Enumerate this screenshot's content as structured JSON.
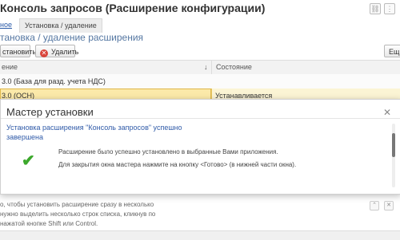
{
  "window": {
    "title": "Консоль запросов (Расширение конфигурации)",
    "icons": [
      "link-icon",
      "more-icon"
    ]
  },
  "tabs": {
    "prev_label": "ное",
    "active_label": "Установка / удаление"
  },
  "section_title": "тановка / удаление расширения",
  "toolbar": {
    "install_label": "становить",
    "delete_label": "Удалить",
    "more_label": "Ещ"
  },
  "table": {
    "col_name_header": "ение",
    "col_state_header": "Состояние",
    "sort_icon": "↓",
    "rows": [
      {
        "name": "3.0 (База для разд. учета НДС)",
        "state": ""
      },
      {
        "name": "3.0 (ОСН)",
        "state": "Устанавливается"
      }
    ]
  },
  "dialog": {
    "title": "Мастер установки",
    "headline": "Установка расширения \"Консоль запросов\" успешно завершена",
    "message1": "Расширение было успешно установлено в выбранные Вами приложения.",
    "message2": "Для закрытия окна мастера нажмите на кнопку <Готово> (в нижней части окна).",
    "icon": "checkmark-icon",
    "close_icon": "close-icon",
    "icon_color": "#3ca82c"
  },
  "hint": {
    "line1": "о, чтобы установить расширение сразу в несколько",
    "line2": "нужно выделить несколько строк списка, кликнув по",
    "line3": "нажатой кнопке Shift или Control."
  },
  "colors": {
    "accent_blue": "#2f5aa8",
    "selection_yellow": "#fbe9a9",
    "delete_red": "#d9453b"
  }
}
